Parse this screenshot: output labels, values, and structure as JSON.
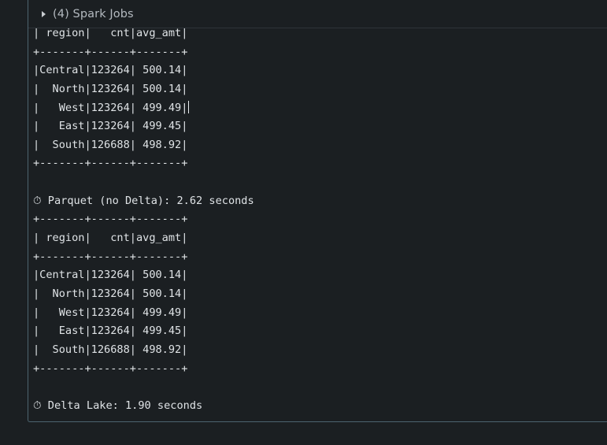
{
  "spark_jobs": {
    "label": "(4) Spark Jobs",
    "expand_icon": "caret-right-icon"
  },
  "output_lines": [
    "| region|   cnt|avg_amt|",
    "+-------+------+-------+",
    "|Central|123264| 500.14|",
    "|  North|123264| 500.14|",
    "|   West|123264| 499.49|",
    "|   East|123264| 499.45|",
    "|  South|126688| 498.92|",
    "+-------+------+-------+",
    "",
    "⏱ Parquet (no Delta): 2.62 seconds",
    "+-------+------+-------+",
    "| region|   cnt|avg_amt|",
    "+-------+------+-------+",
    "|Central|123264| 500.14|",
    "|  North|123264| 500.14|",
    "|   West|123264| 499.49|",
    "|   East|123264| 499.45|",
    "|  South|126688| 498.92|",
    "+-------+------+-------+",
    "",
    "⏱ Delta Lake: 1.90 seconds"
  ],
  "colors": {
    "background": "#1b1f22",
    "text": "#dfe3e6",
    "border": "#4d6470",
    "header_text": "#b3b9bf"
  }
}
